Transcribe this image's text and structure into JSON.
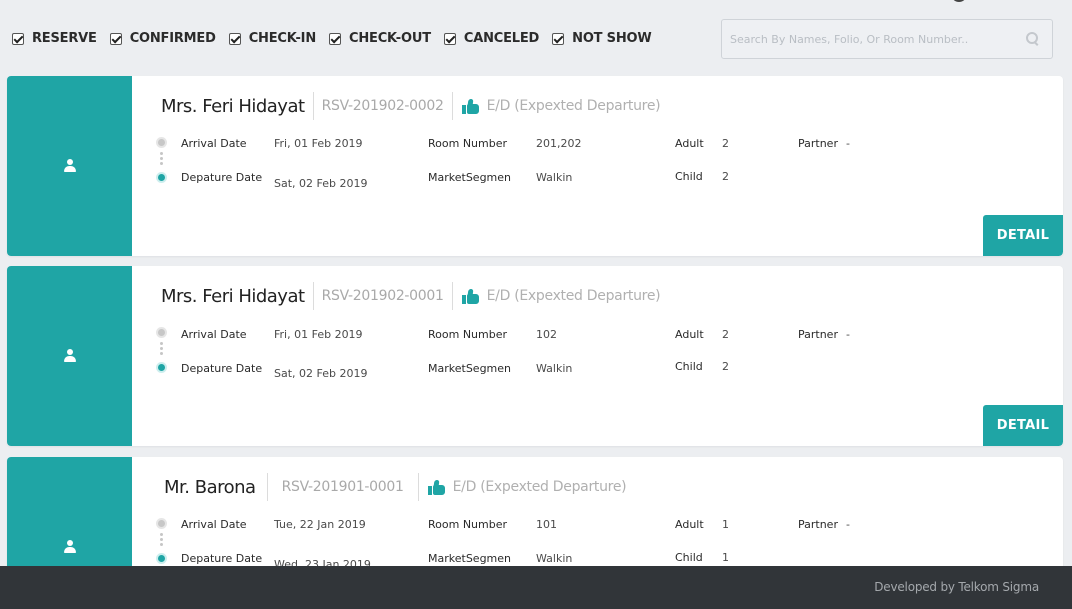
{
  "filters": [
    {
      "label": "RESERVE",
      "checked": true
    },
    {
      "label": "CONFIRMED",
      "checked": true
    },
    {
      "label": "CHECK-IN",
      "checked": true
    },
    {
      "label": "CHECK-OUT",
      "checked": true
    },
    {
      "label": "CANCELED",
      "checked": true
    },
    {
      "label": "NOT SHOW",
      "checked": true
    }
  ],
  "search": {
    "placeholder": "Search By Names, Folio, Or Room Number..",
    "icon": "search-icon"
  },
  "labels": {
    "arrival": "Arrival Date",
    "departure": "Depature Date",
    "room": "Room Number",
    "segment": "MarketSegmen",
    "adult": "Adult",
    "child": "Child",
    "partner": "Partner",
    "detail": "DETAIL"
  },
  "reservations": [
    {
      "name": "Mrs. Feri Hidayat",
      "reservation_no": "RSV-201902-0002",
      "status": "E/D (Expexted Departure)",
      "arrival": "Fri, 01 Feb 2019",
      "departure": "Sat, 02 Feb 2019",
      "room": "201,202",
      "segment": "Walkin",
      "adult": "2",
      "child": "2",
      "partner": "-"
    },
    {
      "name": "Mrs. Feri Hidayat",
      "reservation_no": "RSV-201902-0001",
      "status": "E/D (Expexted Departure)",
      "arrival": "Fri, 01 Feb 2019",
      "departure": "Sat, 02 Feb 2019",
      "room": "102",
      "segment": "Walkin",
      "adult": "2",
      "child": "2",
      "partner": "-"
    },
    {
      "name": "Mr. Barona",
      "reservation_no": "RSV-201901-0001",
      "status": "E/D (Expexted Departure)",
      "arrival": "Tue, 22 Jan 2019",
      "departure": "Wed, 23 Jan 2019",
      "room": "101",
      "segment": "Walkin",
      "adult": "1",
      "child": "1",
      "partner": "-"
    }
  ],
  "footer": {
    "text": "Developed by Telkom Sigma"
  },
  "colors": {
    "accent": "#1fa5a5",
    "background": "#eceef1",
    "footer": "#313539"
  }
}
